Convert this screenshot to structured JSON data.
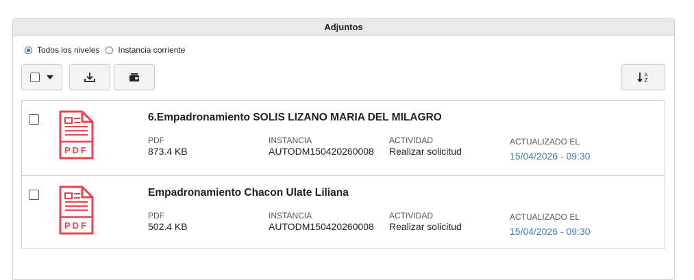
{
  "panel": {
    "title": "Adjuntos"
  },
  "radios": {
    "all_levels": {
      "label": "Todos los niveles",
      "selected": true
    },
    "current_instance": {
      "label": "Instancia corriente",
      "selected": false
    }
  },
  "toolbar": {
    "select_all_icon": "checkbox-dropdown",
    "download_icon": "download-icon",
    "wallet_icon": "wallet-icon",
    "sort_icon": "sort-alpha-icon"
  },
  "labels": {
    "type": "PDF",
    "instance": "INSTANCIA",
    "activity": "ACTIVIDAD",
    "updated": "ACTUALIZADO EL"
  },
  "items": [
    {
      "title": "6.Empadronamiento SOLIS LIZANO MARIA DEL MILAGRO",
      "type": "PDF",
      "size": "873.4 KB",
      "instance": "AUTODM150420260008",
      "activity": "Realizar solicitud",
      "updated": "15/04/2026 - 09:30"
    },
    {
      "title": "Empadronamiento Chacon Ulate Liliana",
      "type": "PDF",
      "size": "502.4 KB",
      "instance": "AUTODM150420260008",
      "activity": "Realizar solicitud",
      "updated": "15/04/2026 - 09:30"
    }
  ],
  "colors": {
    "accent": "#1a73e8",
    "pdf": "#e8424f",
    "date": "#3a7ec0"
  }
}
